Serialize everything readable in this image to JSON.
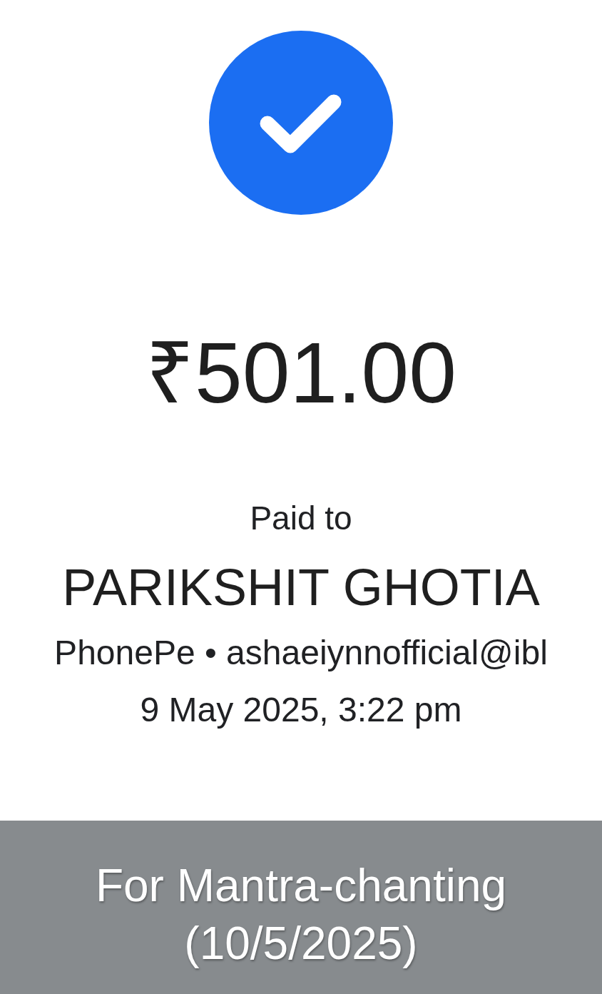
{
  "status": {
    "kind": "success"
  },
  "amount": "₹501.00",
  "recipient": {
    "label": "Paid to",
    "name": "PARIKSHIT GHOTIA",
    "detail": "PhonePe • ashaeiynnofficial@ibl"
  },
  "timestamp": "9 May 2025, 3:22 pm",
  "note": "For Mantra-chanting (10/5/2025)"
}
